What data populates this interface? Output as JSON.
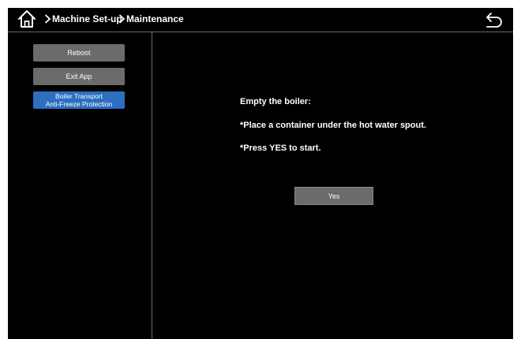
{
  "header": {
    "breadcrumb": [
      "Machine Set-up",
      "Maintenance"
    ]
  },
  "sidebar": {
    "buttons": [
      {
        "label": "Reboot"
      },
      {
        "label": "Exit App"
      },
      {
        "label_line1": "Boiler Transport",
        "label_line2": "Anti-Freeze Protection",
        "active": true
      }
    ]
  },
  "main": {
    "lines": [
      "Empty the boiler:",
      "*Place a container under the hot water spout.",
      "*Press YES to start."
    ],
    "yes_label": "Yes"
  },
  "colors": {
    "background": "#000000",
    "button": "#6b6b6b",
    "active_button": "#2c6fbf",
    "divider": "#6a6a6a",
    "text": "#ffffff"
  },
  "icons": {
    "home": "home-icon",
    "chevron": "chevron-right-icon",
    "back": "back-arrow-icon"
  }
}
